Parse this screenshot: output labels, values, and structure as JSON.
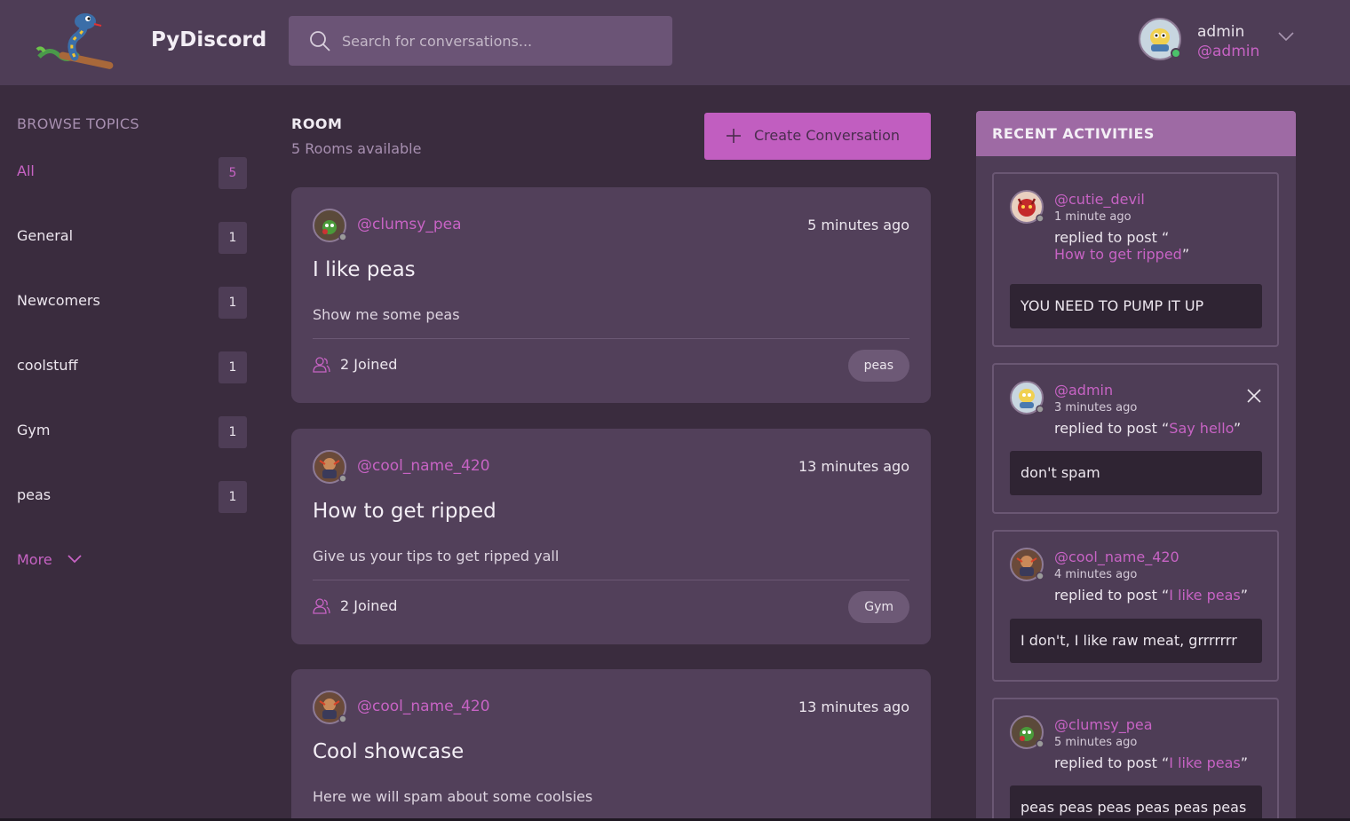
{
  "header": {
    "brand": "PyDiscord",
    "search_placeholder": "Search for conversations...",
    "user": {
      "name": "admin",
      "handle": "@admin"
    }
  },
  "sidebar": {
    "title": "BROWSE TOPICS",
    "topics": [
      {
        "label": "All",
        "count": "5",
        "active": true
      },
      {
        "label": "General",
        "count": "1"
      },
      {
        "label": "Newcomers",
        "count": "1"
      },
      {
        "label": "coolstuff",
        "count": "1"
      },
      {
        "label": "Gym",
        "count": "1"
      },
      {
        "label": "peas",
        "count": "1"
      }
    ],
    "more_label": "More"
  },
  "main": {
    "title": "ROOM",
    "subtitle": "5 Rooms available",
    "create_label": "Create Conversation",
    "rooms": [
      {
        "author": "@clumsy_pea",
        "time": "5 minutes ago",
        "title": "I like peas",
        "description": "Show me some peas",
        "joined": "2 Joined",
        "tag": "peas"
      },
      {
        "author": "@cool_name_420",
        "time": "13 minutes ago",
        "title": "How to get ripped",
        "description": "Give us your tips to get ripped yall",
        "joined": "2 Joined",
        "tag": "Gym"
      },
      {
        "author": "@cool_name_420",
        "time": "13 minutes ago",
        "title": "Cool showcase",
        "description": "Here we will spam about some coolsies"
      }
    ]
  },
  "activity": {
    "title": "RECENT ACTIVITIES",
    "items": [
      {
        "author": "@cutie_devil",
        "time": "1 minute ago",
        "prefix": "replied to post “",
        "post": "How to get ripped",
        "suffix": "”",
        "body": "YOU NEED TO PUMP IT UP"
      },
      {
        "author": "@admin",
        "time": "3 minutes ago",
        "prefix": "replied to post “",
        "post": "Say hello",
        "suffix": "”",
        "body": "don't spam"
      },
      {
        "author": "@cool_name_420",
        "time": "4 minutes ago",
        "prefix": "replied to post “",
        "post": "I like peas",
        "suffix": "”",
        "body": "I don't, I like raw meat, grrrrrrr"
      },
      {
        "author": "@clumsy_pea",
        "time": "5 minutes ago",
        "prefix": "replied to post “",
        "post": "I like peas",
        "suffix": "”",
        "body": "peas peas peas peas peas peas"
      }
    ]
  },
  "colors": {
    "accent": "#c763c4",
    "background": "#3a2c3e",
    "card": "#52405a",
    "header": "#4e3d56"
  }
}
